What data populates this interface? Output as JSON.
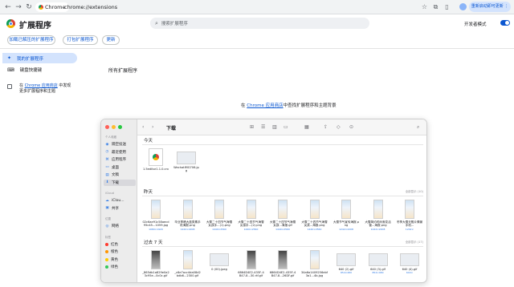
{
  "browser": {
    "tab_chip_label": "Chrome",
    "url": "chrome://extensions",
    "update_button": "重新启动即可更新 ⋮"
  },
  "extensions_page": {
    "title": "扩展程序",
    "search_placeholder": "搜索扩展程序",
    "developer_mode_label": "开发者模式",
    "developer_mode_on": true,
    "buttons": {
      "load_unpacked": "加载已解压的扩展程序",
      "pack": "打包扩展程序",
      "update": "更新"
    },
    "sidebar": {
      "my_extensions": "我的扩展程序",
      "keyboard_shortcuts": "键盘快捷键",
      "store_prefix": "在 ",
      "store_link": "Chrome 应用商店",
      "store_suffix": " 中发现",
      "store_line2": "更多扩展程序和主题"
    },
    "all_extensions_heading": "所有扩展程序",
    "find_more_prefix": "在 ",
    "find_more_link": "Chrome 应用商店",
    "find_more_suffix": "中查找扩展程序和主题背景"
  },
  "finder": {
    "title": "下载",
    "sidebar": {
      "personal_header": "个人收藏",
      "personal_items": [
        {
          "label": "隔空投送",
          "icon": "airdrop-icon"
        },
        {
          "label": "最近使用",
          "icon": "clock-icon"
        },
        {
          "label": "应用程序",
          "icon": "apps-icon"
        },
        {
          "label": "桌面",
          "icon": "desktop-icon"
        },
        {
          "label": "文稿",
          "icon": "document-icon"
        },
        {
          "label": "下载",
          "icon": "download-icon",
          "selected": true
        }
      ],
      "icloud_header": "iCloud",
      "icloud_items": [
        {
          "label": "iClou...",
          "icon": "cloud-icon"
        },
        {
          "label": "共享",
          "icon": "shared-folder-icon"
        }
      ],
      "location_header": "位置",
      "location_items": [
        {
          "label": "网络",
          "icon": "network-icon"
        }
      ],
      "tags_header": "标签",
      "tags": [
        {
          "label": "红色",
          "color": "#ff3b30"
        },
        {
          "label": "橙色",
          "color": "#ff9500"
        },
        {
          "label": "黄色",
          "color": "#ffcc00"
        },
        {
          "label": "绿色",
          "color": "#34c759"
        }
      ]
    },
    "sections": {
      "today": {
        "label": "今天",
        "files": [
          {
            "name": "1.5editor1.1.0.crx",
            "kind": "crx"
          },
          {
            "name": "WechatIMG706.jp\ng",
            "kind": "wide"
          }
        ]
      },
      "yesterday": {
        "label": "昨天",
        "more": "全部显示 (10)",
        "files": [
          {
            "name": "02c6ae91c58aecd95c45...1059.jpg",
            "size": "1080×1920",
            "kind": "png"
          },
          {
            "name": "毕业季晒大蓝类素手机海报.png",
            "size": "1242×2208",
            "kind": "png"
          },
          {
            "name": "大雪二十四节气海雪女孩手...(1).png",
            "size": "1440×2560",
            "kind": "png"
          },
          {
            "name": "大雪二十四节气海雪女孩手...(2).png",
            "size": "1440×2560",
            "kind": "png"
          },
          {
            "name": "大雪二十四节气海雪女孩...海报.gif",
            "size": "1440×2560",
            "kind": "png"
          },
          {
            "name": "大雪二十四节气海雪女孩...海报.png",
            "size": "1440×2560",
            "kind": "png"
          },
          {
            "name": "大雪节气宣传海报.png",
            "size": "1242×2208",
            "kind": "png"
          },
          {
            "name": "大雪简约时尚渐变活营...海报.png",
            "size": "1242×2208",
            "kind": "png"
          },
          {
            "name": "冬季大雪天照片情景手机...",
            "size": "1242×",
            "kind": "png"
          }
        ]
      },
      "last7": {
        "label": "过去 7 天",
        "more": "全部显示 (17)",
        "files": [
          {
            "name": "_865db1a829e0a23c95e...0c0c.gif",
            "kind": "dark"
          },
          {
            "name": "_c6e7acc4da08d2bdb6...2300.gif",
            "kind": "png"
          },
          {
            "name": "0 (00).jpeg",
            "kind": "wide"
          },
          {
            "name": "6864D4E2-435F-4B47-8...30.rtf.gif",
            "kind": "dark"
          },
          {
            "name": "6864D4E2-435F-4B47-8...26DF.gif",
            "kind": "dark"
          },
          {
            "name": "34a6a1409256ebf3a1...4b.jpg",
            "kind": "png"
          },
          {
            "name": "640 (2).gif",
            "size": "854×480",
            "kind": "wide"
          },
          {
            "name": "640 (3).gif",
            "size": "854×480",
            "kind": "wide"
          },
          {
            "name": "640 (4).gif",
            "size": "640×",
            "kind": "wide"
          }
        ]
      }
    }
  }
}
